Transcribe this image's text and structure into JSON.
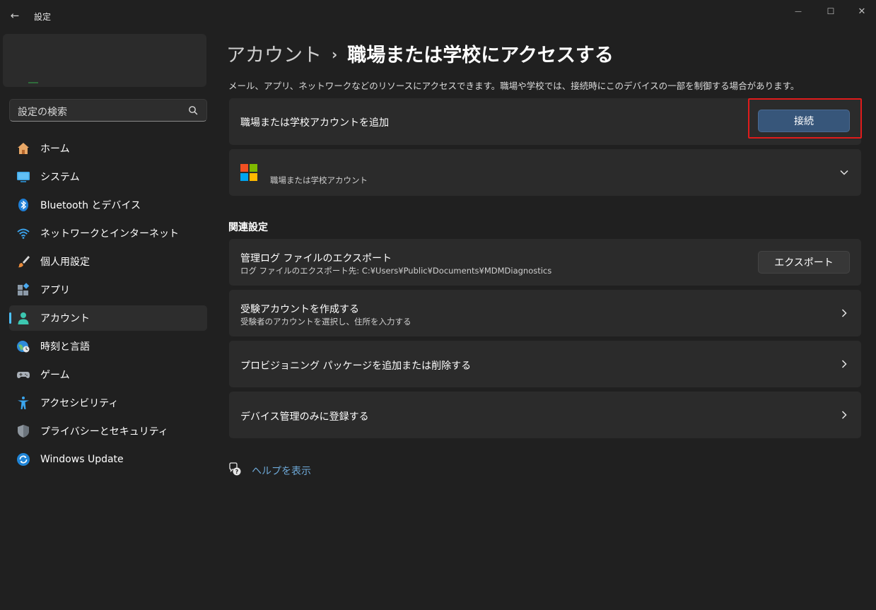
{
  "window": {
    "title": "設定",
    "back_icon": "←",
    "min_icon": "—",
    "max_icon": "☐",
    "close_icon": "✕"
  },
  "search": {
    "placeholder": "設定の検索"
  },
  "sidebar": {
    "items": [
      {
        "label": "ホーム",
        "icon": "home-icon"
      },
      {
        "label": "システム",
        "icon": "system-icon"
      },
      {
        "label": "Bluetooth とデバイス",
        "icon": "bluetooth-icon"
      },
      {
        "label": "ネットワークとインターネット",
        "icon": "wifi-icon"
      },
      {
        "label": "個人用設定",
        "icon": "brush-icon"
      },
      {
        "label": "アプリ",
        "icon": "apps-icon"
      },
      {
        "label": "アカウント",
        "icon": "account-icon",
        "active": true
      },
      {
        "label": "時刻と言語",
        "icon": "globe-clock-icon"
      },
      {
        "label": "ゲーム",
        "icon": "gamepad-icon"
      },
      {
        "label": "アクセシビリティ",
        "icon": "accessibility-icon"
      },
      {
        "label": "プライバシーとセキュリティ",
        "icon": "shield-icon"
      },
      {
        "label": "Windows Update",
        "icon": "update-icon"
      }
    ]
  },
  "header": {
    "parent": "アカウント",
    "separator": "›",
    "current": "職場または学校にアクセスする",
    "description": "メール、アプリ、ネットワークなどのリソースにアクセスできます。職場や学校では、接続時にこのデバイスの一部を制御する場合があります。"
  },
  "add_account": {
    "title": "職場または学校アカウントを追加",
    "button": "接続"
  },
  "existing_account": {
    "label": "職場または学校アカウント"
  },
  "related": {
    "title": "関連設定",
    "export": {
      "title": "管理ログ ファイルのエクスポート",
      "subtitle": "ログ ファイルのエクスポート先: C:¥Users¥Public¥Documents¥MDMDiagnostics",
      "button": "エクスポート"
    },
    "test_account": {
      "title": "受験アカウントを作成する",
      "subtitle": "受験者のアカウントを選択し、住所を入力する"
    },
    "provisioning": {
      "title": "プロビジョニング パッケージを追加または削除する"
    },
    "device_mgmt": {
      "title": "デバイス管理のみに登録する"
    }
  },
  "help": {
    "label": "ヘルプを表示"
  },
  "colors": {
    "background": "#202020",
    "card": "#2b2b2b",
    "accent": "#4cc2ff",
    "accent_button": "#37567a",
    "highlight": "#e01b1b",
    "link": "#6ea9d8"
  }
}
